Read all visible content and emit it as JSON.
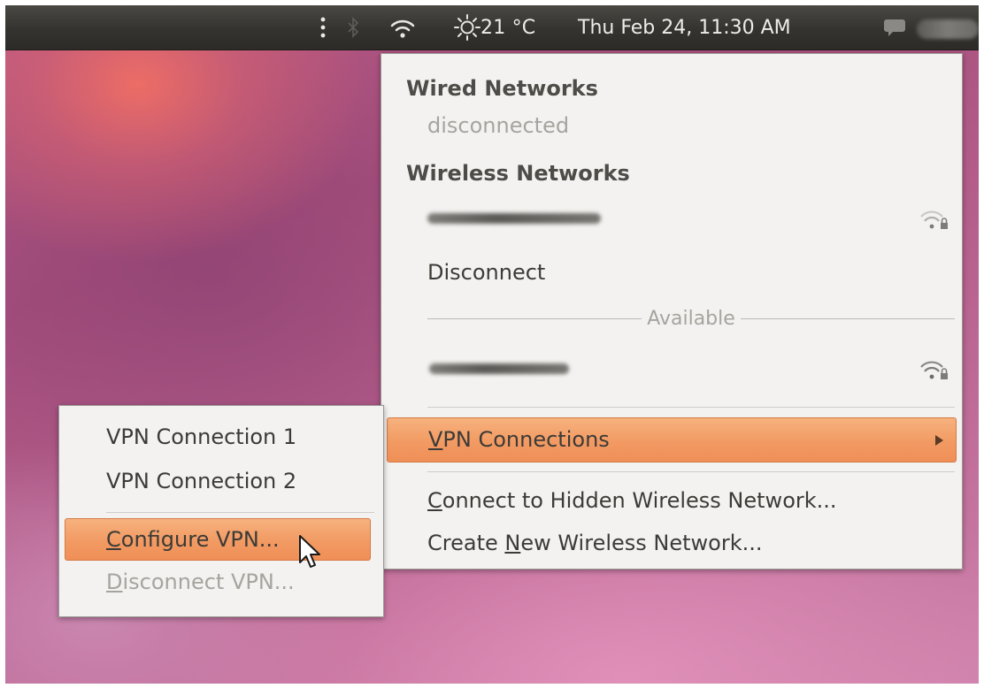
{
  "top_panel": {
    "icons": [
      "menu-dots-icon",
      "bluetooth-icon",
      "wifi-signal-icon",
      "weather-sun-icon",
      "chat-bubble-icon"
    ],
    "temperature": "21 °C",
    "clock": "Thu Feb 24, 11:30 AM"
  },
  "network_menu": {
    "wired_header": "Wired Networks",
    "wired_status": "disconnected",
    "wireless_header": "Wireless Networks",
    "disconnect_label": "Disconnect",
    "available_label": "Available",
    "vpn_connections": {
      "mnemonic": "V",
      "rest": "PN Connections"
    },
    "connect_hidden": {
      "mnemonic": "C",
      "rest": "onnect to Hidden Wireless Network..."
    },
    "create_new": {
      "before": "Create ",
      "mnemonic": "N",
      "rest": "ew Wireless Network..."
    }
  },
  "vpn_submenu": {
    "connection_1": "VPN Connection 1",
    "connection_2": "VPN Connection 2",
    "configure": {
      "mnemonic": "C",
      "rest": "onfigure VPN..."
    },
    "disconnect": {
      "mnemonic": "D",
      "rest": "isconnect VPN..."
    }
  },
  "colors": {
    "highlight": "#f29a63",
    "menu_bg": "#f3f2f0",
    "panel_bg": "#34332f"
  }
}
